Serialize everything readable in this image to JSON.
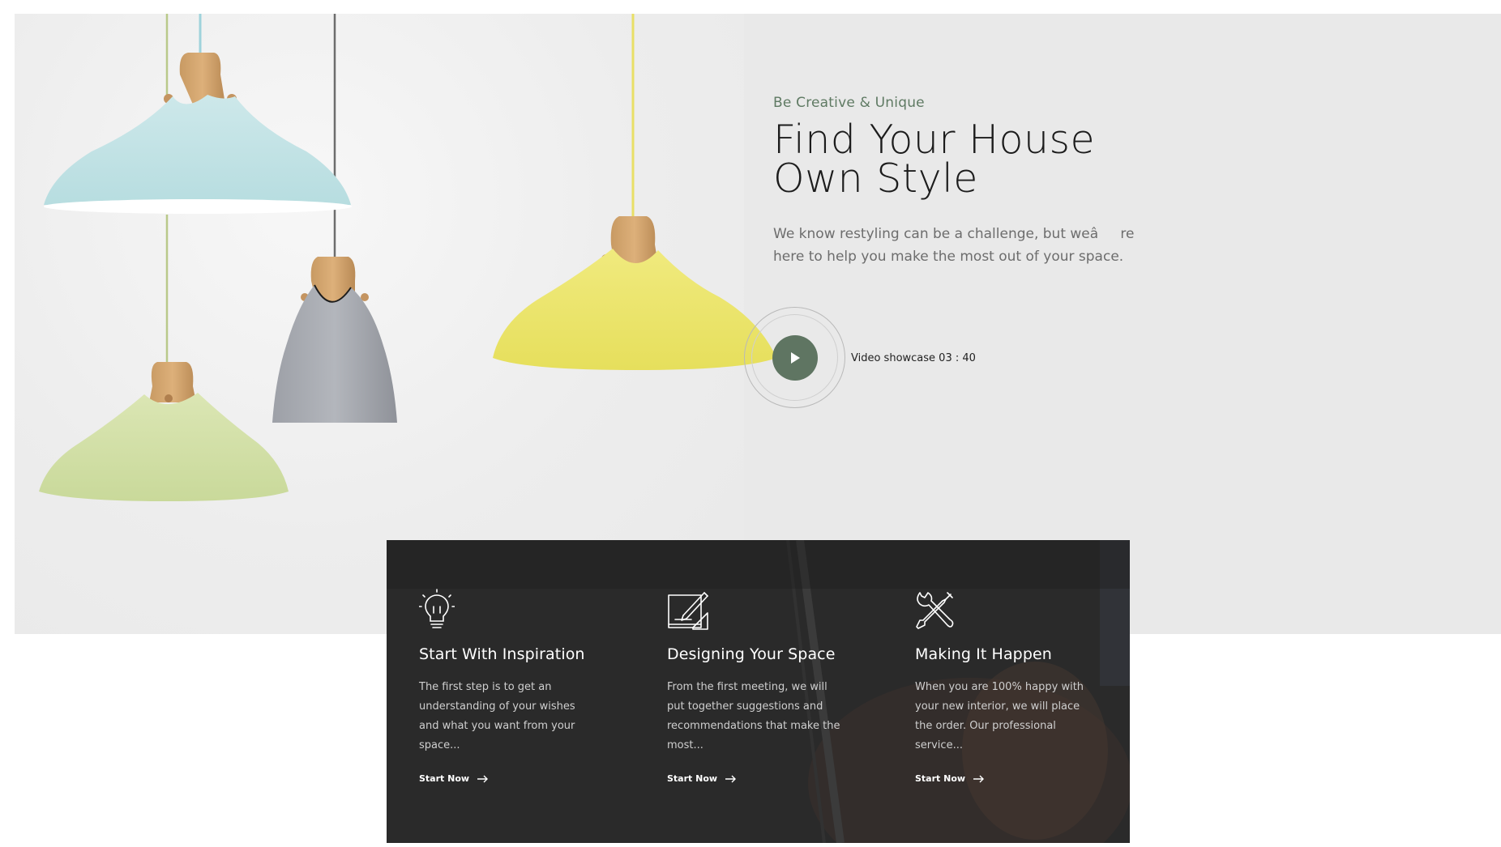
{
  "hero": {
    "subtitle": "Be Creative & Unique",
    "title_line1": "Find Your House",
    "title_line2": "Own Style",
    "description": "We know restyling can be a challenge, but weâre here to help you make the most out of your space."
  },
  "video": {
    "label": "Video showcase 03 : 40",
    "icon": "play-icon"
  },
  "colors": {
    "accent": "#5f7562",
    "subtitle": "#5f7a63",
    "hero_bg": "#e9e9e9",
    "features_bg": "#2a2a2a"
  },
  "features": [
    {
      "icon": "lightbulb-icon",
      "title": "Start With Inspiration",
      "text": "The first step is to get an understanding of your wishes and what you want from your space...",
      "cta": "Start Now"
    },
    {
      "icon": "design-sketch-icon",
      "title": "Designing Your Space",
      "text": "From the first meeting, we will put together suggestions and recommendations that make the most...",
      "cta": "Start Now"
    },
    {
      "icon": "tools-icon",
      "title": "Making It Happen",
      "text": "When you are 100% happy with your new interior, we will place the order. Our professional service...",
      "cta": "Start Now"
    }
  ]
}
